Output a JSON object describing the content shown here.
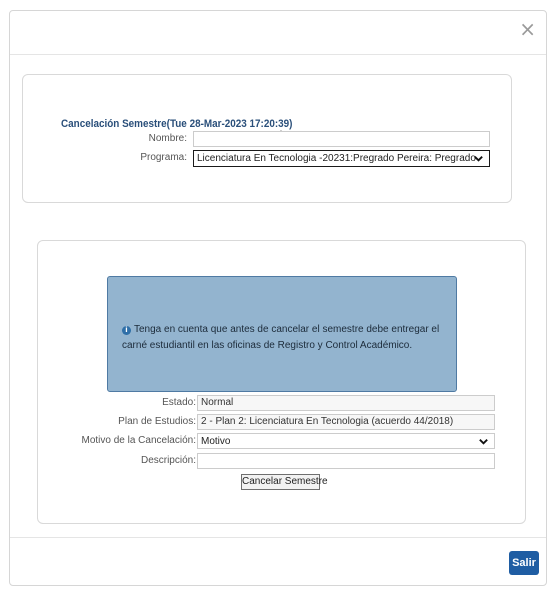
{
  "dialog": {
    "close_glyph": "×",
    "exit_label": "Salir"
  },
  "header_form": {
    "title": "Cancelación Semestre(Tue 28-Mar-2023 17:20:39)",
    "nombre_label": "Nombre:",
    "nombre_value": "",
    "programa_label": "Programa:",
    "programa_value": "Licenciatura En Tecnologia -20231:Pregrado Pereira: Pregrado"
  },
  "cancel_form": {
    "alert_icon": "info-icon",
    "alert_text": "Tenga en cuenta que antes de cancelar el semestre debe entregar el carné estudiantil en las oficinas de Registro y Control Académico.",
    "estado_label": "Estado:",
    "estado_value": "Normal",
    "plan_label": "Plan de Estudios:",
    "plan_value": "2 - Plan 2: Licenciatura En Tecnologia (acuerdo 44/2018)",
    "motivo_label": "Motivo de la Cancelación:",
    "motivo_value": "Motivo",
    "descripcion_label": "Descripción:",
    "descripcion_value": "",
    "submit_label": "Cancelar Semestre"
  },
  "colors": {
    "title": "#2a4f7a",
    "alert_bg": "#93b4cf",
    "alert_border": "#4f7aa3",
    "primary_button": "#1f5da3"
  }
}
